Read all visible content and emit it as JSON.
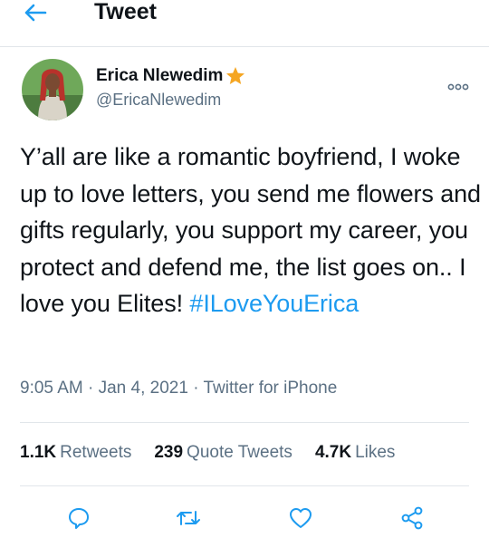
{
  "header": {
    "title": "Tweet",
    "back_icon": "arrow-left-icon"
  },
  "colors": {
    "accent": "#1d9bf0",
    "secondary_text": "#5b7083",
    "star": "#f5a623",
    "divider": "#e1e6ea"
  },
  "tweet": {
    "author_name": "Erica Nlewedim",
    "handle": "@EricaNlewedim",
    "text": "Y’all are like a romantic boyfriend, I woke up to love letters, you send me flowers and gifts regularly, you support my career, you protect and defend me, the list goes on.. I love you Elites! ",
    "hashtag": "#ILoveYouErica",
    "time": "9:05 AM",
    "separator": " · ",
    "date": "Jan 4, 2021",
    "source": "Twitter for iPhone"
  },
  "stats": {
    "retweets_count": "1.1K",
    "retweets_label": "Retweets",
    "quote_count": "239",
    "quote_label": "Quote Tweets",
    "likes_count": "4.7K",
    "likes_label": "Likes"
  },
  "actions": [
    "reply-icon",
    "retweet-icon",
    "like-icon",
    "share-icon"
  ]
}
